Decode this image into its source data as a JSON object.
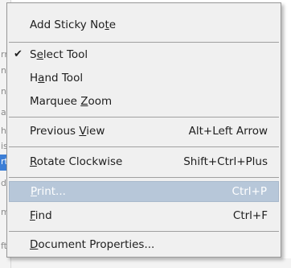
{
  "menu": {
    "items": [
      {
        "before": "Add Sticky No",
        "mnemonic": "t",
        "after": "e",
        "shortcut": ""
      },
      {
        "before": "S",
        "mnemonic": "e",
        "after": "lect Tool",
        "shortcut": "",
        "checked": true,
        "check_glyph": "✔"
      },
      {
        "before": "H",
        "mnemonic": "a",
        "after": "nd Tool",
        "shortcut": ""
      },
      {
        "before": "Marquee ",
        "mnemonic": "Z",
        "after": "oom",
        "shortcut": ""
      },
      {
        "before": "Previous ",
        "mnemonic": "V",
        "after": "iew",
        "shortcut": "Alt+Left Arrow"
      },
      {
        "before": "",
        "mnemonic": "R",
        "after": "otate Clockwise",
        "shortcut": "Shift+Ctrl+Plus"
      },
      {
        "before": "",
        "mnemonic": "P",
        "after": "rint...",
        "shortcut": "Ctrl+P",
        "highlighted": true
      },
      {
        "before": "",
        "mnemonic": "F",
        "after": "ind",
        "shortcut": "Ctrl+F"
      },
      {
        "before": "",
        "mnemonic": "D",
        "after": "ocument Properties...",
        "shortcut": ""
      }
    ]
  },
  "background": {
    "glyphs": [
      "rr",
      "n",
      "ne",
      "ag",
      "h",
      "is",
      "rt",
      "di",
      "mi",
      "ft"
    ]
  },
  "colors": {
    "menu_bg": "#f0f0f0",
    "highlight_bg": "#b7c7d9",
    "separator": "#a0a0a0",
    "selection_blue": "#3d7fd6"
  }
}
